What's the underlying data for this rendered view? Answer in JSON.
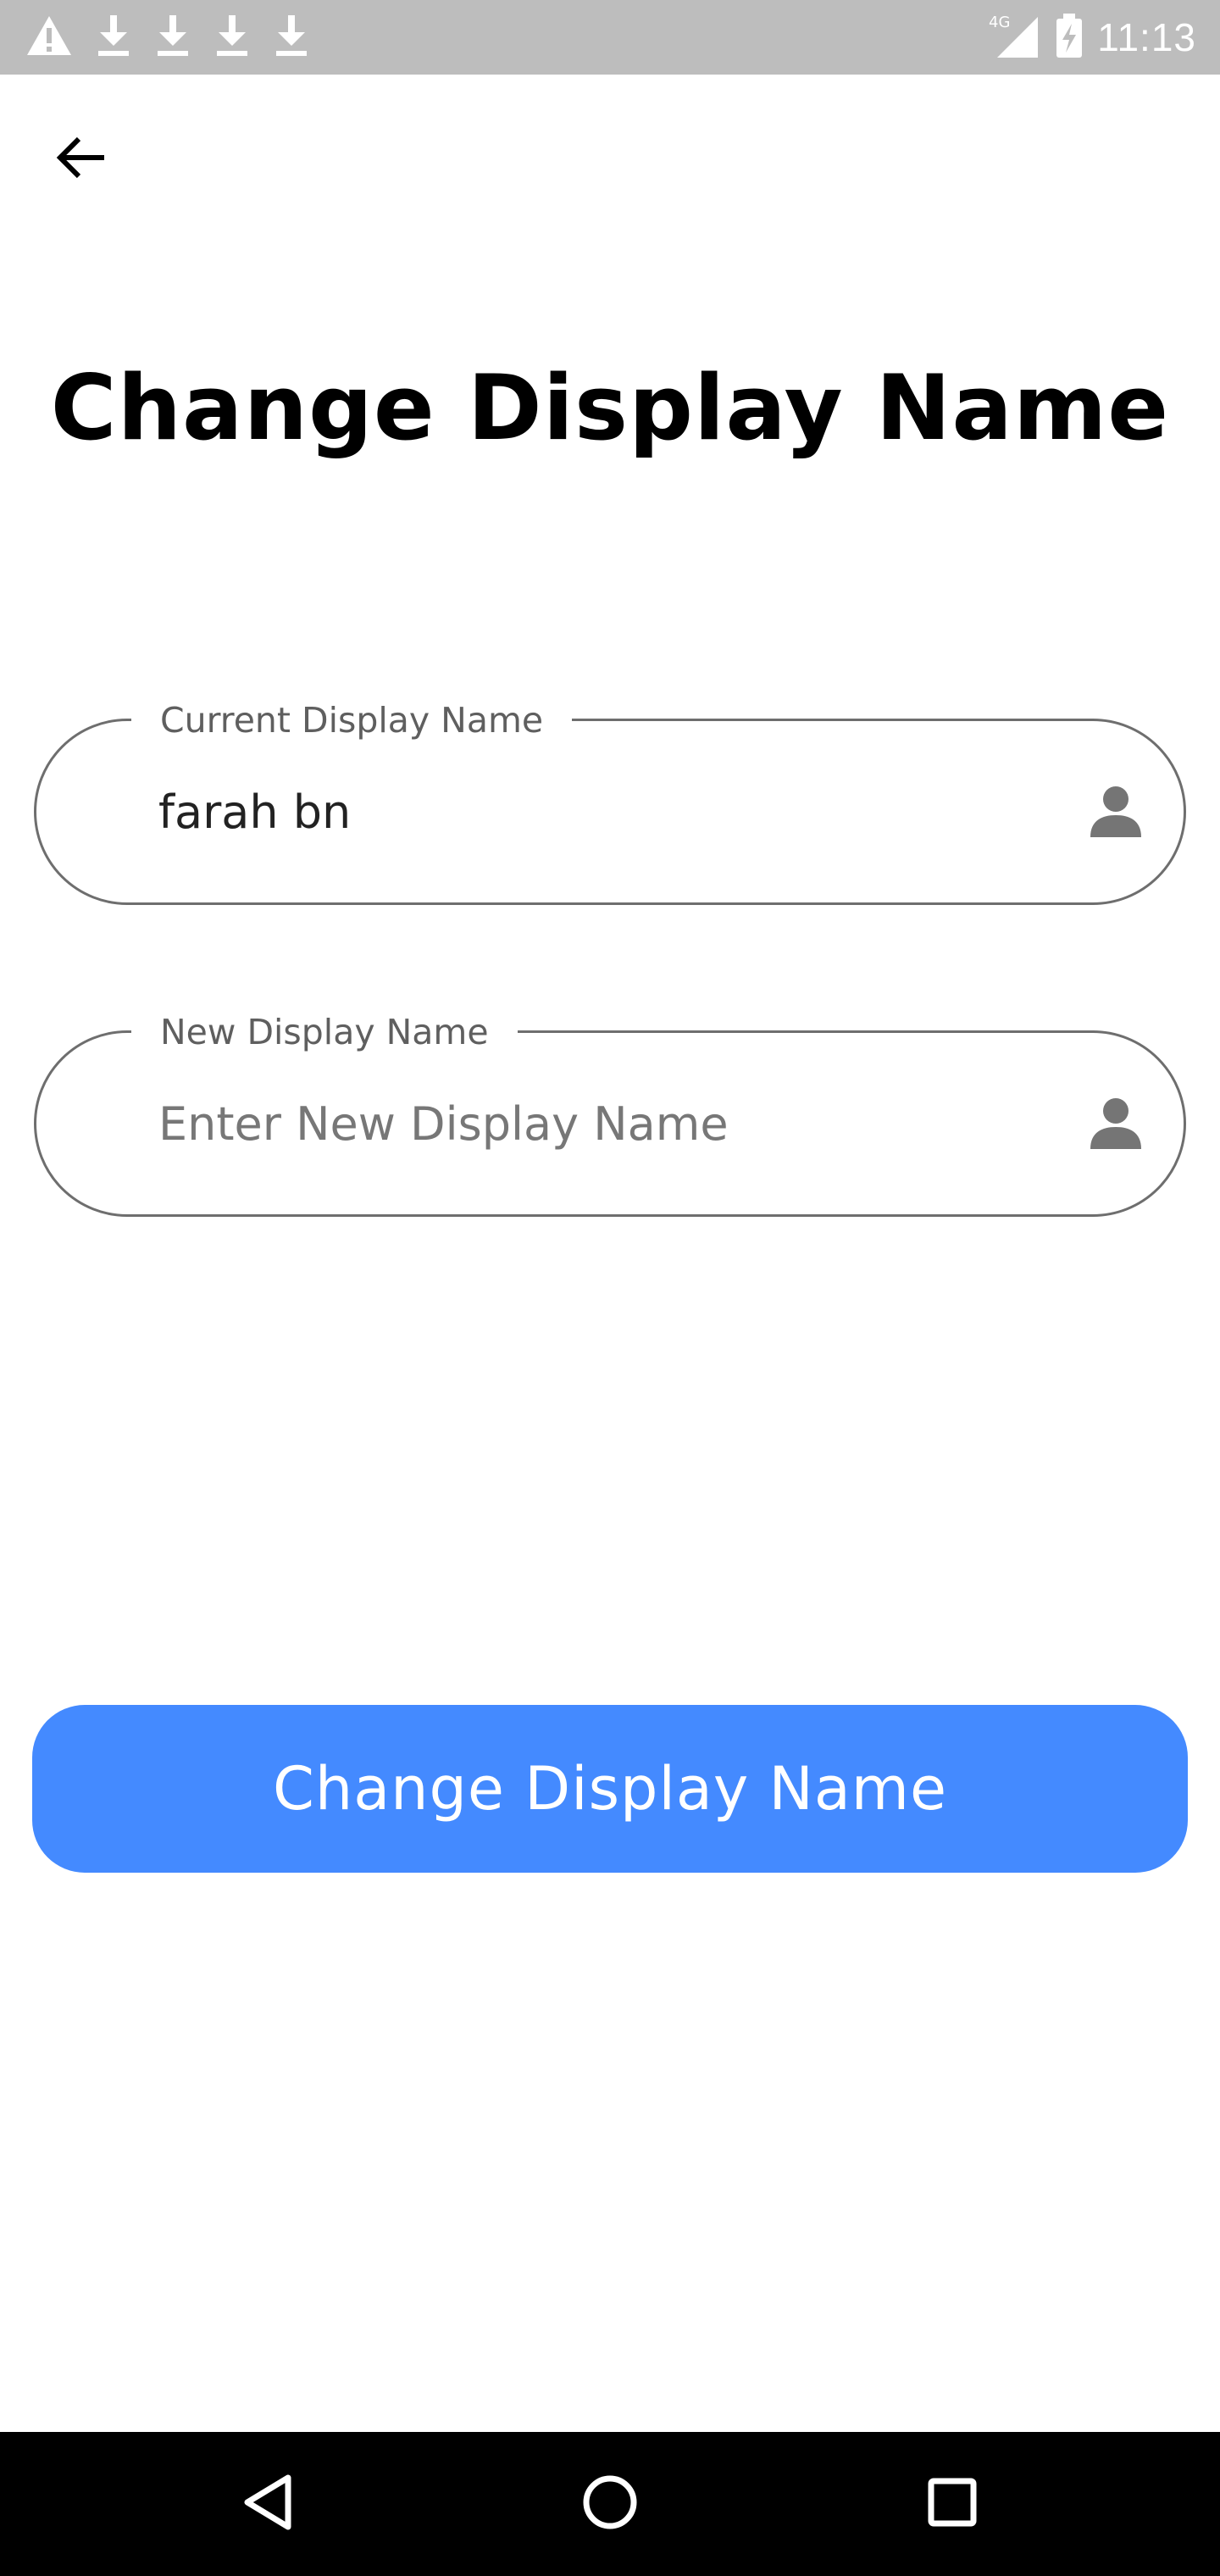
{
  "status_bar": {
    "time": "11:13",
    "network": "4G",
    "notification_icons": [
      "warning-icon",
      "download-icon",
      "download-icon",
      "download-icon",
      "download-icon"
    ]
  },
  "header": {
    "back_icon": "arrow-left-icon"
  },
  "title": "Change Display Name",
  "fields": {
    "current": {
      "label": "Current Display Name",
      "value": "farah bn",
      "icon": "person-icon"
    },
    "new": {
      "label": "New Display Name",
      "placeholder": "Enter New Display Name",
      "value": "",
      "icon": "person-icon"
    }
  },
  "submit_button": {
    "label": "Change Display Name"
  },
  "colors": {
    "accent": "#448aff",
    "status_bar": "#bdbdbd",
    "field_border": "#6e6e6e",
    "nav_bar": "#000000"
  },
  "nav_bar": {
    "buttons": [
      "back-triangle-icon",
      "home-circle-icon",
      "recents-square-icon"
    ]
  }
}
